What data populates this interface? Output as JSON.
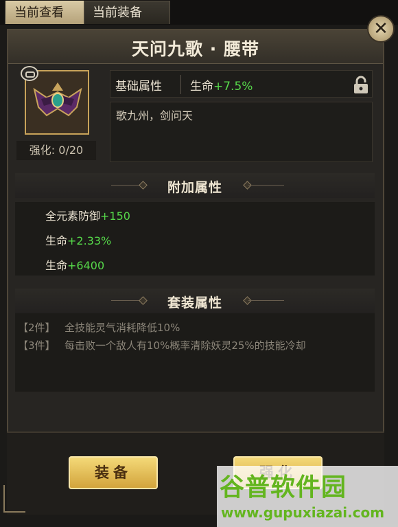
{
  "tabs": [
    {
      "label": "当前查看"
    },
    {
      "label": "当前装备"
    }
  ],
  "item": {
    "title": "天问九歌 · 腰带",
    "enhance_label": "强化: 0/20",
    "base_attr_label": "基础属性",
    "base_attr_stat": "生命",
    "base_attr_value": "+7.5%",
    "description": "歌九州，剑问天"
  },
  "extra_attrs": {
    "header": "附加属性",
    "lines": [
      {
        "stat": "全元素防御",
        "value": "+150"
      },
      {
        "stat": "生命",
        "value": "+2.33%"
      },
      {
        "stat": "生命",
        "value": "+6400"
      }
    ]
  },
  "set_attrs": {
    "header": "套装属性",
    "entries": [
      {
        "tag": "【2件】",
        "text": "全技能灵气消耗降低10%"
      },
      {
        "tag": "【3件】",
        "text": "每击败一个敌人有10%概率清除妖灵25%的技能冷却"
      }
    ]
  },
  "buttons": {
    "equip": "装备",
    "strengthen": "强化"
  },
  "watermark": {
    "brand": "谷普软件园",
    "url": "www.gupuxiazai.com"
  },
  "colors": {
    "accent_gold": "#d2a43c",
    "bonus_green": "#56d94a"
  },
  "icons": [
    "close-icon",
    "lock-icon",
    "item-belt-icon",
    "chat-badge-icon"
  ]
}
